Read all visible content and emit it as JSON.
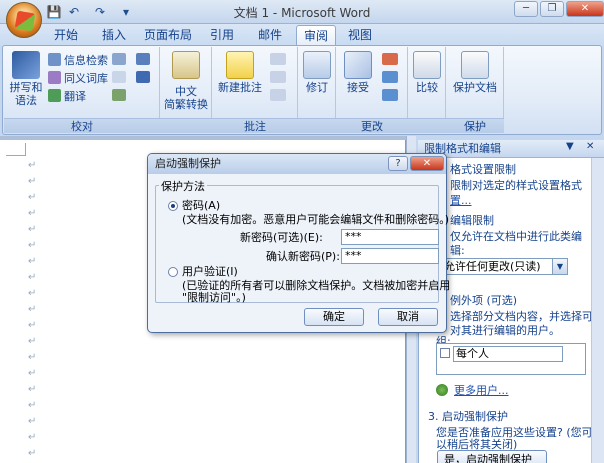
{
  "window": {
    "title": "文档 1 - Microsoft Word"
  },
  "qat": {
    "save": "💾",
    "undo": "↶",
    "redo": "↷",
    "more": "▾"
  },
  "tabs": [
    "开始",
    "插入",
    "页面布局",
    "引用",
    "邮件",
    "审阅",
    "视图"
  ],
  "ribbon": {
    "proofing": {
      "label": "校对",
      "spelling": "拼写和\n语法",
      "research": "信息检索",
      "thesaurus": "同义词库",
      "translate": "翻译"
    },
    "chinese": {
      "label": "中文\n简繁转换"
    },
    "comments": {
      "label": "批注",
      "new_comment": "新建批注"
    },
    "tracking": {
      "track": "修订"
    },
    "changes": {
      "label": "更改",
      "accept": "接受"
    },
    "compare": {
      "label": "比较"
    },
    "protect": {
      "label": "保护",
      "protect_doc": "保护文档"
    }
  },
  "pane": {
    "title": "限制格式和编辑",
    "s1_heading": "格式设置限制",
    "s1_text1": "限制对选定的样式设置格式",
    "s1_link": "置...",
    "s2_heading": "编辑限制",
    "s2_text1": "仅允许在文档中进行此类编",
    "s2_text2": "辑:",
    "s2_select": "允许任何更改(只读)",
    "s2_exceptions": "例外项 (可选)",
    "s2_text3": "选择部分文档内容，并选择可以",
    "s2_text4": "对其进行编辑的用户。",
    "s2_groups": "组:",
    "s2_everyone": "每个人",
    "s2_more_users": "更多用户...",
    "s3_heading": "3. 启动强制保护",
    "s3_text1": "您是否准备应用这些设置? (您可",
    "s3_text2": "以稍后将其关闭)",
    "s3_button": "是，启动强制保护"
  },
  "dialog": {
    "title": "启动强制保护",
    "help": "?",
    "close": "✕",
    "group": "保护方法",
    "opt_password": "密码(A)",
    "password_desc": "(文档没有加密。恶意用户可能会编辑文件和删除密码。)",
    "new_pwd_label": "新密码(可选)(E):",
    "new_pwd_value": "***",
    "confirm_label": "确认新密码(P):",
    "confirm_value": "***",
    "opt_user": "用户验证(I)",
    "user_desc1": "(已验证的所有者可以删除文档保护。文档被加密并启用",
    "user_desc2": "\"限制访问\"。)",
    "ok": "确定",
    "cancel": "取消"
  }
}
